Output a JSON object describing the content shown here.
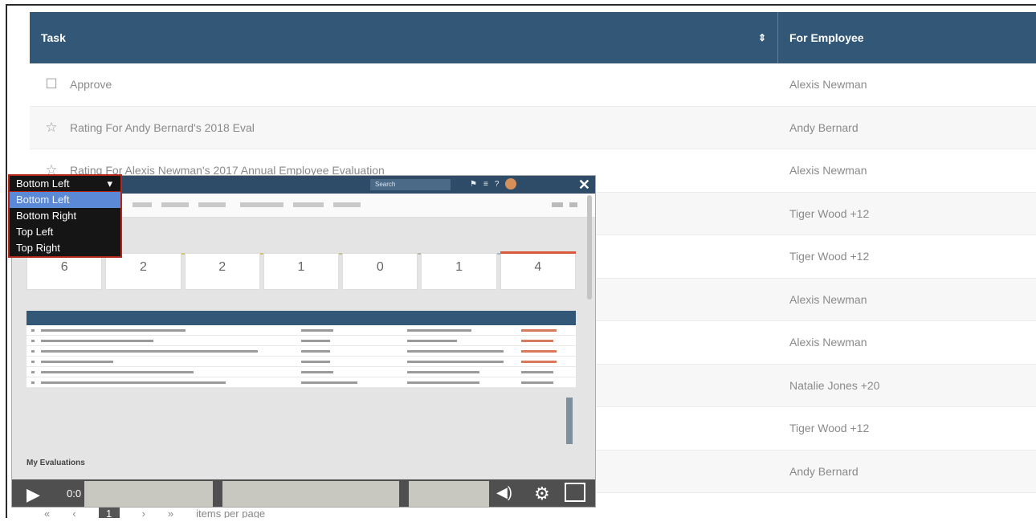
{
  "table": {
    "headers": {
      "task": "Task",
      "employee": "For Employee"
    },
    "rows": [
      {
        "icon": "clipboard-icon",
        "task": "Approve",
        "employee": "Alexis Newman"
      },
      {
        "icon": "star-icon",
        "task": "Rating For Andy Bernard's 2018 Eval",
        "employee": "Andy Bernard"
      },
      {
        "icon": "star-icon",
        "task": "Rating For Alexis Newman's 2017 Annual Employee Evaluation",
        "employee": "Alexis Newman"
      },
      {
        "icon": "",
        "task": "",
        "employee": "Tiger Wood +12"
      },
      {
        "icon": "",
        "task": "",
        "employee": "Tiger Wood +12"
      },
      {
        "icon": "",
        "task": "",
        "employee": "Alexis Newman"
      },
      {
        "icon": "",
        "task": "",
        "employee": "Alexis Newman"
      },
      {
        "icon": "",
        "task": "",
        "employee": "Natalie Jones +20"
      },
      {
        "icon": "",
        "task": "",
        "employee": "Tiger Wood +12"
      },
      {
        "icon": "",
        "task": "",
        "employee": "Andy Bernard"
      }
    ]
  },
  "pager": {
    "current_page": "1",
    "items_per_page_label": "items per page"
  },
  "video": {
    "search_placeholder": "Search",
    "cards": [
      "6",
      "2",
      "2",
      "1",
      "0",
      "1",
      "4"
    ],
    "section_label": "My Evaluations",
    "time": "0:0",
    "position_select": {
      "selected": "Bottom Left",
      "options": [
        "Bottom Left",
        "Bottom Right",
        "Top Left",
        "Top Right"
      ]
    }
  },
  "colors": {
    "header_bg": "#335777",
    "dropdown_border": "#b2261c",
    "dropdown_active": "#5b89d6"
  }
}
